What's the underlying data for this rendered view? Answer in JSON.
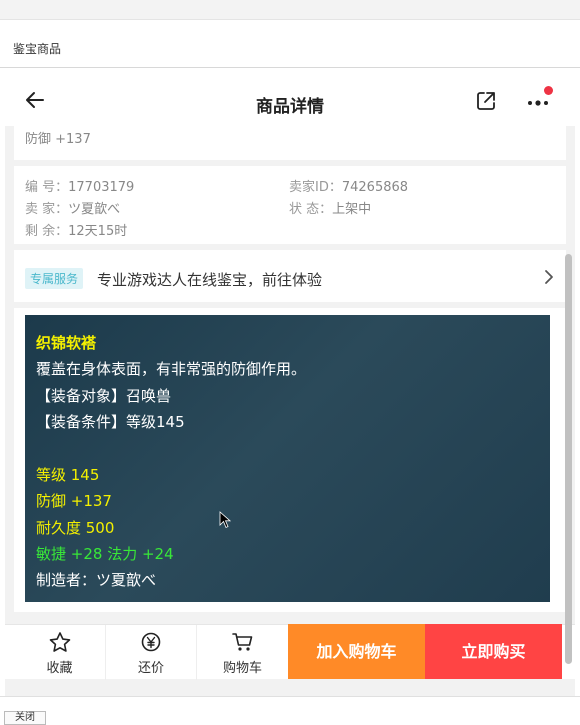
{
  "window": {
    "title": "鉴宝商品",
    "watermark": "",
    "close_label": "关闭"
  },
  "nav": {
    "title": "商品详情",
    "back_icon": "arrow-left-icon",
    "share_icon": "share-icon",
    "more_icon": "more-icon",
    "badge_color": "#ee3344"
  },
  "top_stat": "防御 +137",
  "info": {
    "serial_label": "编 号：",
    "serial_value": "17703179",
    "seller_id_label": "卖家ID：",
    "seller_id_value": "74265868",
    "seller_label": "卖 家：",
    "seller_value": "ツ夏歆べ",
    "status_label": "状 态：",
    "status_value": "上架中",
    "remaining_label": "剩 余：",
    "remaining_value": "12天15时"
  },
  "service": {
    "tag": "专属服务",
    "text": "专业游戏达人在线鉴宝，前往体验"
  },
  "item": {
    "name": "织锦软褡",
    "desc": "覆盖在身体表面，有非常强的防御作用。",
    "target": "【装备对象】召唤兽",
    "condition": "【装备条件】等级145",
    "level": "等级 145",
    "defense": "防御 +137",
    "durability": "耐久度 500",
    "bonus": "敏捷 +28 法力 +24",
    "maker": "制造者：ツ夏歆べ"
  },
  "tabbar": {
    "favorite": "收藏",
    "bargain": "还价",
    "cart": "购物车",
    "add_to_cart": "加入购物车",
    "buy_now": "立即购买"
  },
  "colors": {
    "cart_button": "#ff8a27",
    "buy_button": "#ff4444",
    "item_yellow": "#f4f000",
    "item_green": "#38e838",
    "service_tag": "#4bb8cc"
  }
}
